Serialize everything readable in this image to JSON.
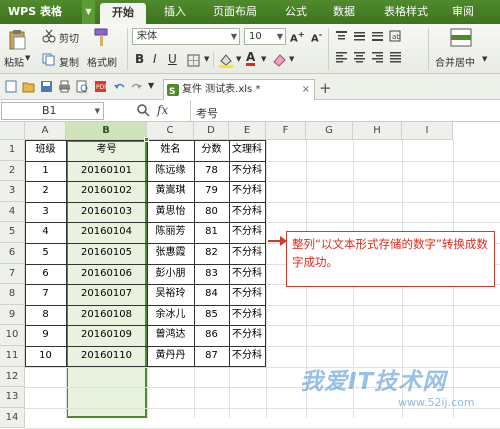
{
  "app": {
    "title": "WPS 表格"
  },
  "menu": {
    "tabs": [
      "开始",
      "插入",
      "页面布局",
      "公式",
      "数据",
      "表格样式",
      "审阅"
    ],
    "active": "开始"
  },
  "toolbar": {
    "paste": "粘贴",
    "cut": "剪切",
    "copy": "复制",
    "format_painter": "格式刷",
    "font_name": "宋体",
    "font_size": "10",
    "merge_center": "合并居中"
  },
  "document": {
    "tab_title": "复件 测试表.xls *"
  },
  "formula_bar": {
    "cell_ref": "B1",
    "fx": "fx",
    "content": "考号"
  },
  "columns": [
    "A",
    "B",
    "C",
    "D",
    "E",
    "F",
    "G",
    "H",
    "I"
  ],
  "rows": [
    "1",
    "2",
    "3",
    "4",
    "5",
    "6",
    "7",
    "8",
    "9",
    "10",
    "11",
    "12",
    "13",
    "14"
  ],
  "table": {
    "headers": [
      "班级",
      "考号",
      "姓名",
      "分数",
      "文理科"
    ],
    "data": [
      [
        "1",
        "20160101",
        "陈远缘",
        "78",
        "不分科"
      ],
      [
        "2",
        "20160102",
        "黄嵩琪",
        "79",
        "不分科"
      ],
      [
        "3",
        "20160103",
        "黄思怡",
        "80",
        "不分科"
      ],
      [
        "4",
        "20160104",
        "陈丽芳",
        "81",
        "不分科"
      ],
      [
        "5",
        "20160105",
        "张惠霞",
        "82",
        "不分科"
      ],
      [
        "6",
        "20160106",
        "彭小朋",
        "83",
        "不分科"
      ],
      [
        "7",
        "20160107",
        "吴裕玲",
        "84",
        "不分科"
      ],
      [
        "8",
        "20160108",
        "余冰儿",
        "85",
        "不分科"
      ],
      [
        "9",
        "20160109",
        "曾鸿达",
        "86",
        "不分科"
      ],
      [
        "10",
        "20160110",
        "黄丹丹",
        "87",
        "不分科"
      ]
    ]
  },
  "callout": {
    "text": "整列“以文本形式存储的数字”转换成数字成功。"
  },
  "watermark": {
    "text": "我爱IT技术网",
    "url": "www.52ij.com"
  },
  "colors": {
    "accent": "#4f8a2c",
    "selection": "#e8f2de",
    "callout": "#e02a1a"
  }
}
